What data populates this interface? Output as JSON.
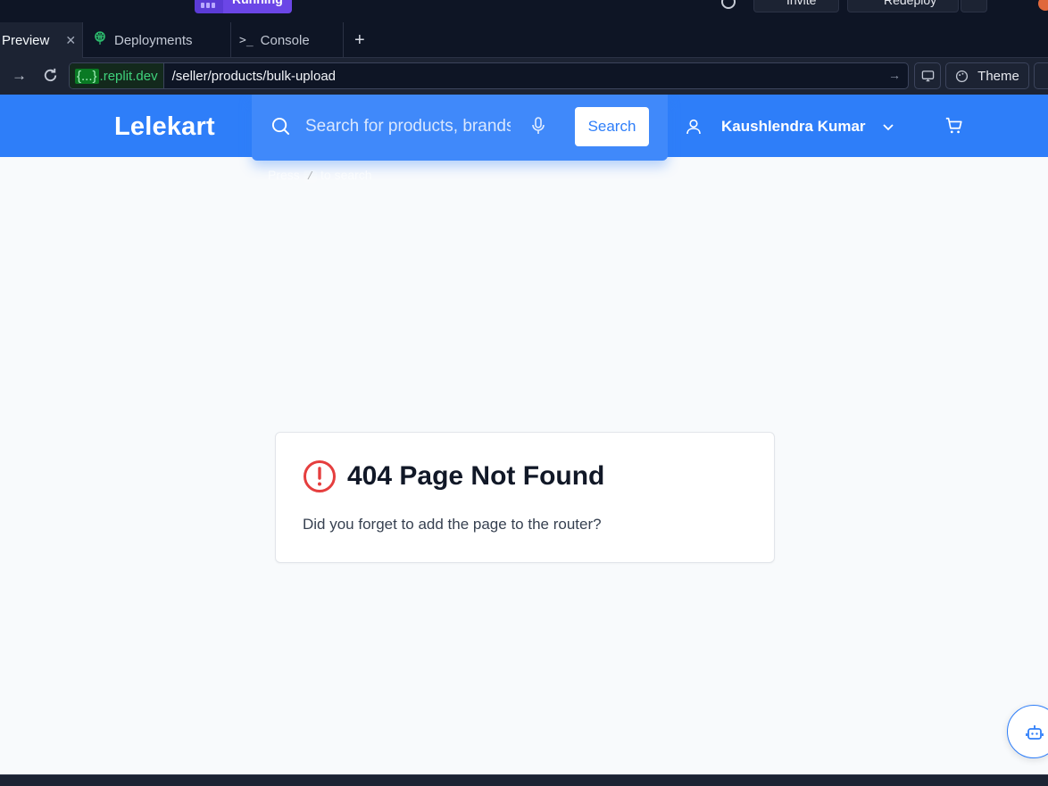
{
  "top": {
    "run_label": "Running",
    "invite_label": "Invite",
    "redeploy_label": "Redeploy"
  },
  "tabs": [
    {
      "label": "Preview",
      "icon": "preview",
      "active": true
    },
    {
      "label": "Deployments",
      "icon": "deployments-icon"
    },
    {
      "label": "Console",
      "icon": "console-icon"
    }
  ],
  "urlbar": {
    "domain_brace": "{...}",
    "domain_suffix": ".replit.dev",
    "path": "/seller/products/bulk-upload",
    "theme_label": "Theme"
  },
  "app": {
    "logo": "Lelekart",
    "search": {
      "placeholder": "Search for products, brands and more",
      "button_label": "Search",
      "hint_press": "Press",
      "hint_key": "/",
      "hint_rest": "to search"
    },
    "user_name": "Kaushlendra Kumar",
    "brand_color": "#2e7ef9",
    "error": {
      "title": "404 Page Not Found",
      "message": "Did you forget to add the page to the router?",
      "icon_color": "#e53e3e"
    }
  }
}
